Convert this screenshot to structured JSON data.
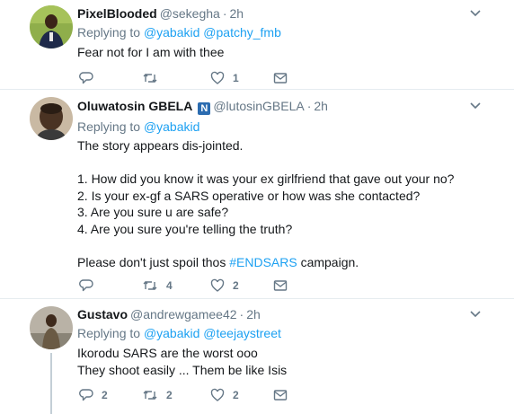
{
  "tweets": [
    {
      "name": "PixelBlooded",
      "handle": "@sekegha",
      "time": "2h",
      "replying_prefix": "Replying to",
      "replying_to": [
        "@yabakid",
        "@patchy_fmb"
      ],
      "text": "Fear not for I am with thee",
      "actions": {
        "reply": "",
        "retweet": "",
        "like": "1",
        "mail": ""
      }
    },
    {
      "name": "Oluwatosin GBELA",
      "badge": "N",
      "handle": "@lutosinGBELA",
      "time": "2h",
      "replying_prefix": "Replying to",
      "replying_to": [
        "@yabakid"
      ],
      "text_intro": "The story appears dis-jointed.",
      "questions": [
        "1. How did you know it was your ex girlfriend that gave out your no?",
        "2. Is your ex-gf a SARS operative or how was she contacted?",
        "3. Are you sure u are safe?",
        "4. Are you sure you're telling the truth?"
      ],
      "closing_before": "Please don't just spoil thos ",
      "hashtag": "#ENDSARS",
      "closing_after": " campaign.",
      "actions": {
        "reply": "",
        "retweet": "4",
        "like": "2",
        "mail": ""
      }
    },
    {
      "name": "Gustavo",
      "handle": "@andrewgamee42",
      "time": "2h",
      "replying_prefix": "Replying to",
      "replying_to": [
        "@yabakid",
        "@teejaystreet"
      ],
      "lines": [
        "Ikorodu SARS are the worst ooo",
        "They shoot easily ... Them be like Isis"
      ],
      "actions": {
        "reply": "2",
        "retweet": "2",
        "like": "2",
        "mail": ""
      }
    }
  ],
  "colors": {
    "link": "#1da1f2",
    "muted": "#657786",
    "border": "#e6ecf0",
    "text": "#14171a"
  },
  "icons": [
    "chevron-down-icon",
    "reply-icon",
    "retweet-icon",
    "like-icon",
    "direct-message-icon",
    "verified-badge-icon"
  ]
}
